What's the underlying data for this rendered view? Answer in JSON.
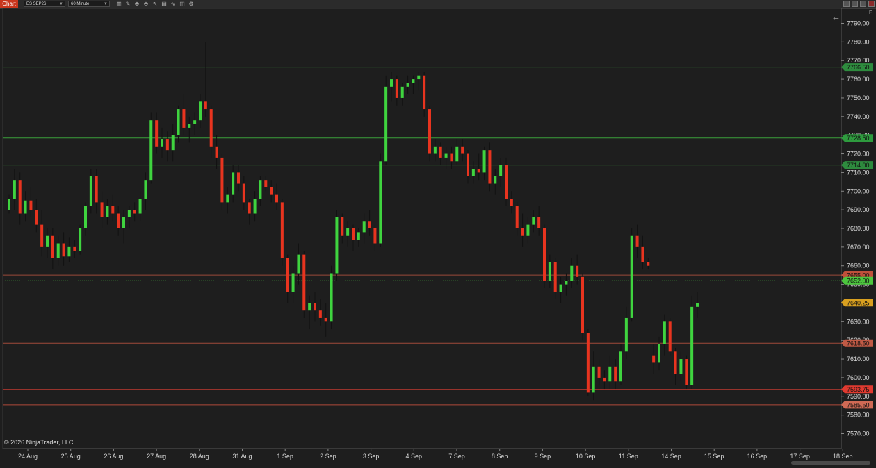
{
  "toolbar": {
    "chart_tab": "Chart",
    "instrument": "ES SEP26",
    "timeframe": "60 Minute",
    "tools": [
      "bar-chart-icon",
      "pencil-icon",
      "zoom-in-icon",
      "zoom-out-icon",
      "pointer-icon",
      "properties-icon",
      "indicators-icon",
      "strategies-icon",
      "gear-icon"
    ]
  },
  "chart_data": {
    "type": "candlestick",
    "symbol": "ES SEP26",
    "interval": "60 Minute",
    "ylim": [
      7562,
      7798
    ],
    "y_ticks": [
      "7570.00",
      "7580.00",
      "7590.00",
      "7600.00",
      "7610.00",
      "7620.00",
      "7630.00",
      "7640.00",
      "7650.00",
      "7660.00",
      "7670.00",
      "7680.00",
      "7690.00",
      "7700.00",
      "7710.00",
      "7720.00",
      "7730.00",
      "7740.00",
      "7750.00",
      "7760.00",
      "7770.00",
      "7780.00",
      "7790.00"
    ],
    "x_labels": [
      "24 Aug",
      "25 Aug",
      "26 Aug",
      "27 Aug",
      "28 Aug",
      "31 Aug",
      "1 Sep",
      "2 Sep",
      "3 Sep",
      "4 Sep",
      "7 Sep",
      "8 Sep",
      "9 Sep",
      "10 Sep",
      "11 Sep",
      "14 Sep",
      "15 Sep",
      "16 Sep",
      "17 Sep",
      "18 Sep"
    ],
    "current_price": {
      "label": "7640.25",
      "value": 7640.25,
      "color": "#d9a020"
    },
    "levels": [
      {
        "label": "7766.50",
        "value": 7766.5,
        "color": "#3a8f3a",
        "badge": "#2e8b3e"
      },
      {
        "label": "7728.50",
        "value": 7728.5,
        "color": "#3a9f3a",
        "badge": "#2e9b3e"
      },
      {
        "label": "7714.00",
        "value": 7714.0,
        "color": "#3a8f3a",
        "badge": "#2e8b3e"
      },
      {
        "label": "7655.00",
        "value": 7655.0,
        "color": "#9a4a3a",
        "badge": "#c0503a"
      },
      {
        "label": "7652.00",
        "value": 7652.0,
        "color": "#46b03a",
        "badge": "#4cc63e",
        "dotted": true
      },
      {
        "label": "7618.50",
        "value": 7618.5,
        "color": "#a04a3a",
        "badge": "#c05a45"
      },
      {
        "label": "7593.75",
        "value": 7593.75,
        "color": "#c03a30",
        "badge": "#e03a30"
      },
      {
        "label": "7585.50",
        "value": 7585.5,
        "color": "#b04a3a",
        "badge": "#d06a55"
      }
    ],
    "series": [
      [
        7690,
        7698,
        7688,
        7696
      ],
      [
        7696,
        7712,
        7690,
        7706
      ],
      [
        7706,
        7710,
        7682,
        7688
      ],
      [
        7688,
        7700,
        7684,
        7695
      ],
      [
        7695,
        7702,
        7686,
        7690
      ],
      [
        7690,
        7696,
        7678,
        7682
      ],
      [
        7682,
        7690,
        7665,
        7670
      ],
      [
        7670,
        7680,
        7664,
        7676
      ],
      [
        7676,
        7680,
        7658,
        7664
      ],
      [
        7664,
        7676,
        7660,
        7672
      ],
      [
        7672,
        7678,
        7660,
        7665
      ],
      [
        7665,
        7675,
        7662,
        7670
      ],
      [
        7670,
        7674,
        7664,
        7668
      ],
      [
        7668,
        7682,
        7666,
        7680
      ],
      [
        7680,
        7694,
        7676,
        7692
      ],
      [
        7692,
        7712,
        7688,
        7708
      ],
      [
        7708,
        7712,
        7688,
        7694
      ],
      [
        7694,
        7700,
        7680,
        7686
      ],
      [
        7686,
        7696,
        7682,
        7692
      ],
      [
        7692,
        7698,
        7684,
        7688
      ],
      [
        7688,
        7692,
        7676,
        7680
      ],
      [
        7680,
        7690,
        7672,
        7686
      ],
      [
        7686,
        7692,
        7680,
        7690
      ],
      [
        7690,
        7694,
        7684,
        7688
      ],
      [
        7688,
        7700,
        7684,
        7696
      ],
      [
        7696,
        7710,
        7690,
        7706
      ],
      [
        7706,
        7742,
        7704,
        7738
      ],
      [
        7738,
        7742,
        7720,
        7724
      ],
      [
        7724,
        7734,
        7718,
        7728
      ],
      [
        7728,
        7732,
        7716,
        7722
      ],
      [
        7722,
        7736,
        7716,
        7730
      ],
      [
        7730,
        7746,
        7726,
        7744
      ],
      [
        7744,
        7752,
        7730,
        7734
      ],
      [
        7734,
        7740,
        7726,
        7736
      ],
      [
        7736,
        7742,
        7730,
        7738
      ],
      [
        7738,
        7752,
        7734,
        7748
      ],
      [
        7748,
        7780,
        7740,
        7744
      ],
      [
        7744,
        7746,
        7718,
        7724
      ],
      [
        7724,
        7730,
        7712,
        7718
      ],
      [
        7718,
        7720,
        7690,
        7694
      ],
      [
        7694,
        7702,
        7688,
        7698
      ],
      [
        7698,
        7714,
        7694,
        7710
      ],
      [
        7710,
        7714,
        7700,
        7704
      ],
      [
        7704,
        7708,
        7690,
        7694
      ],
      [
        7694,
        7696,
        7682,
        7688
      ],
      [
        7688,
        7700,
        7684,
        7696
      ],
      [
        7696,
        7708,
        7692,
        7706
      ],
      [
        7706,
        7708,
        7700,
        7702
      ],
      [
        7702,
        7706,
        7694,
        7698
      ],
      [
        7698,
        7704,
        7690,
        7694
      ],
      [
        7694,
        7696,
        7660,
        7664
      ],
      [
        7664,
        7666,
        7640,
        7646
      ],
      [
        7646,
        7660,
        7640,
        7656
      ],
      [
        7656,
        7672,
        7650,
        7666
      ],
      [
        7666,
        7668,
        7632,
        7636
      ],
      [
        7636,
        7644,
        7626,
        7640
      ],
      [
        7640,
        7646,
        7630,
        7636
      ],
      [
        7636,
        7642,
        7628,
        7632
      ],
      [
        7632,
        7640,
        7622,
        7630
      ],
      [
        7630,
        7660,
        7626,
        7656
      ],
      [
        7656,
        7690,
        7652,
        7686
      ],
      [
        7686,
        7688,
        7672,
        7676
      ],
      [
        7676,
        7684,
        7670,
        7680
      ],
      [
        7680,
        7682,
        7668,
        7674
      ],
      [
        7674,
        7680,
        7670,
        7678
      ],
      [
        7678,
        7688,
        7672,
        7684
      ],
      [
        7684,
        7690,
        7676,
        7680
      ],
      [
        7680,
        7682,
        7668,
        7672
      ],
      [
        7672,
        7720,
        7670,
        7716
      ],
      [
        7716,
        7762,
        7714,
        7756
      ],
      [
        7756,
        7764,
        7748,
        7760
      ],
      [
        7760,
        7762,
        7746,
        7750
      ],
      [
        7750,
        7758,
        7746,
        7756
      ],
      [
        7756,
        7762,
        7752,
        7758
      ],
      [
        7758,
        7762,
        7752,
        7760
      ],
      [
        7760,
        7764,
        7754,
        7762
      ],
      [
        7762,
        7764,
        7740,
        7744
      ],
      [
        7744,
        7746,
        7716,
        7720
      ],
      [
        7720,
        7728,
        7716,
        7724
      ],
      [
        7724,
        7726,
        7714,
        7718
      ],
      [
        7718,
        7724,
        7712,
        7720
      ],
      [
        7720,
        7724,
        7712,
        7716
      ],
      [
        7716,
        7728,
        7714,
        7724
      ],
      [
        7724,
        7728,
        7716,
        7720
      ],
      [
        7720,
        7722,
        7704,
        7708
      ],
      [
        7708,
        7716,
        7704,
        7712
      ],
      [
        7712,
        7720,
        7706,
        7710
      ],
      [
        7710,
        7724,
        7706,
        7722
      ],
      [
        7722,
        7726,
        7700,
        7704
      ],
      [
        7704,
        7712,
        7698,
        7708
      ],
      [
        7708,
        7718,
        7702,
        7714
      ],
      [
        7714,
        7718,
        7692,
        7696
      ],
      [
        7696,
        7700,
        7688,
        7692
      ],
      [
        7692,
        7694,
        7676,
        7680
      ],
      [
        7680,
        7688,
        7670,
        7676
      ],
      [
        7676,
        7686,
        7672,
        7682
      ],
      [
        7682,
        7690,
        7678,
        7686
      ],
      [
        7686,
        7692,
        7676,
        7680
      ],
      [
        7680,
        7682,
        7648,
        7652
      ],
      [
        7652,
        7666,
        7648,
        7662
      ],
      [
        7662,
        7664,
        7642,
        7646
      ],
      [
        7646,
        7654,
        7640,
        7650
      ],
      [
        7650,
        7656,
        7644,
        7652
      ],
      [
        7652,
        7664,
        7648,
        7660
      ],
      [
        7660,
        7666,
        7650,
        7654
      ],
      [
        7654,
        7656,
        7620,
        7624
      ],
      [
        7624,
        7626,
        7590,
        7592
      ],
      [
        7592,
        7614,
        7588,
        7606
      ],
      [
        7606,
        7610,
        7596,
        7600
      ],
      [
        7600,
        7604,
        7594,
        7598
      ],
      [
        7598,
        7612,
        7594,
        7606
      ],
      [
        7606,
        7610,
        7594,
        7598
      ],
      [
        7598,
        7618,
        7596,
        7614
      ],
      [
        7614,
        7638,
        7610,
        7632
      ],
      [
        7632,
        7680,
        7630,
        7676
      ],
      [
        7676,
        7682,
        7664,
        7670
      ],
      [
        7670,
        7676,
        7658,
        7662
      ],
      [
        7662,
        7664,
        7658,
        7660
      ],
      [
        7612,
        7618,
        7602,
        7608
      ],
      [
        7608,
        7622,
        7604,
        7618
      ],
      [
        7618,
        7634,
        7612,
        7630
      ],
      [
        7630,
        7632,
        7612,
        7614
      ],
      [
        7614,
        7616,
        7596,
        7602
      ],
      [
        7602,
        7614,
        7598,
        7610
      ],
      [
        7610,
        7612,
        7594,
        7596
      ],
      [
        7596,
        7644,
        7594,
        7638
      ],
      [
        7638,
        7646,
        7632,
        7640
      ]
    ]
  },
  "footer": {
    "copyright": "© 2026 NinjaTrader, LLC"
  }
}
